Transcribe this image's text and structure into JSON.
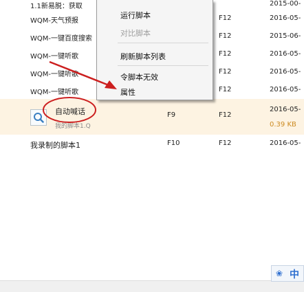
{
  "rows": [
    {
      "name": "1.1新易脱：获取",
      "key1": "",
      "key2": "",
      "date": "2015-00-"
    },
    {
      "name": "WQM-天气预报",
      "key1": "",
      "key2": "F12",
      "date": "2016-05-"
    },
    {
      "name": "WQM-一键百度搜索",
      "key1": "",
      "key2": "F12",
      "date": "2015-06-"
    },
    {
      "name": "WQM-一键听歌",
      "key1": "",
      "key2": "F12",
      "date": "2016-05-"
    },
    {
      "name": "WQM-一键听歌",
      "key1": "",
      "key2": "F12",
      "date": "2016-05-"
    },
    {
      "name": "WQM-一键听歌",
      "key1": "",
      "key2": "F12",
      "date": "2016-05-"
    }
  ],
  "selected_row": {
    "name": "自动喊话",
    "subpath": "我的脚本1.Q",
    "key1": "F9",
    "key2": "F12",
    "date": "2016-05-",
    "size": "0.39 KB"
  },
  "last_row": {
    "name": "我录制的脚本1",
    "key1": "F10",
    "key2": "F12",
    "date": "2016-05-"
  },
  "context_menu": {
    "items": [
      {
        "label": "运行脚本",
        "disabled": false
      },
      {
        "label": "对比脚本",
        "disabled": true
      },
      {
        "label": "刷新脚本列表",
        "disabled": false
      },
      {
        "label": "令脚本无效",
        "disabled": false
      },
      {
        "label": "属性",
        "disabled": false
      }
    ]
  },
  "ime": {
    "label": "中"
  },
  "colors": {
    "selected_bg": "#fdf3e2",
    "annotation_red": "#cc1f1f",
    "size_text": "#cc8a20"
  }
}
